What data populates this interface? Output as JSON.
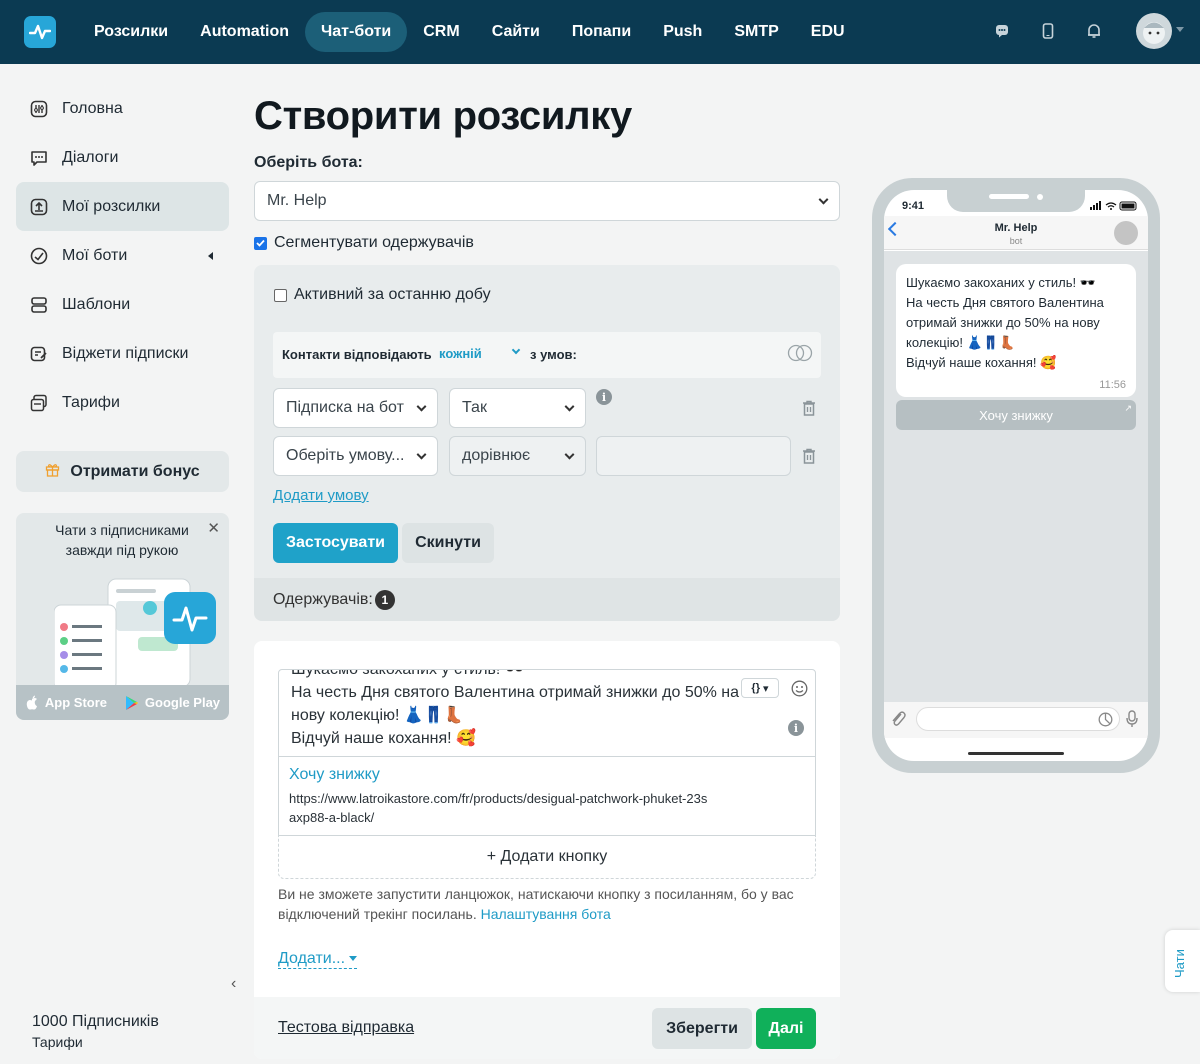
{
  "nav": {
    "items": [
      "Розсилки",
      "Automation",
      "Чат-боти",
      "CRM",
      "Сайти",
      "Попапи",
      "Push",
      "SMTP",
      "EDU"
    ],
    "active_index": 2
  },
  "sidebar": {
    "items": [
      {
        "label": "Головна",
        "icon": "dashboard-icon"
      },
      {
        "label": "Діалоги",
        "icon": "chat-icon"
      },
      {
        "label": "Мої розсилки",
        "icon": "upload-icon"
      },
      {
        "label": "Мої боти",
        "icon": "bot-icon"
      },
      {
        "label": "Шаблони",
        "icon": "templates-icon"
      },
      {
        "label": "Віджети підписки",
        "icon": "widget-icon"
      },
      {
        "label": "Тарифи",
        "icon": "tariffs-icon"
      }
    ],
    "active_index": 2,
    "bonus_label": "Отримати бонус",
    "promo_text": "Чати з підписниками завжди під рукою",
    "app_store": "App Store",
    "google_play": "Google Play",
    "subscribers": "1000 Підписників",
    "tariffs_link": "Тарифи"
  },
  "main": {
    "title": "Створити розсилку",
    "bot_label": "Оберіть бота:",
    "bot_value": "Mr. Help",
    "segment_label": "Сегментувати одержувачів",
    "active_label": "Активний за останню добу",
    "cond_prefix": "Контакти відповідають",
    "cond_mode": "кожній",
    "cond_suffix": "з умов:",
    "row1": {
      "field": "Підписка на бот",
      "op": "Так"
    },
    "row2": {
      "field": "Оберіть умову...",
      "op": "дорівнює",
      "value": ""
    },
    "add_condition": "Додати умову",
    "apply": "Застосувати",
    "reset": "Скинути",
    "recipients_label": "Одержувачів:",
    "recipients_count": "1",
    "message_lines": [
      "Шукаємо закоханих у стиль! 🕶️",
      "На честь Дня святого Валентина отримай знижки до 50% на нову колекцію! 👗👖👢",
      "Відчуй наше кохання! 🥰"
    ],
    "var_button": "{}",
    "button_name": "Хочу знижку",
    "button_url": "https://www.latroikastore.com/fr/products/desigual-patchwork-phuket-23saxp88-a-black/",
    "add_button": "+ Додати кнопку",
    "note": "Ви не зможете запустити ланцюжок, натискаючи кнопку з посиланням, бо у вас відключений трекінг посилань.",
    "note_link": "Налаштування бота",
    "add_more": "Додати...",
    "test_send": "Тестова відправка",
    "save": "Зберегти",
    "next": "Далі"
  },
  "preview": {
    "time": "9:41",
    "bot_name": "Mr. Help",
    "bot_sub": "bot",
    "message": "Шукаємо закоханих у стиль! 🕶️\nНа честь Дня святого Валентина отримай знижки до 50% на нову колекцію! 👗👖👢\nВідчуй наше кохання! 🥰",
    "msg_time": "11:56",
    "button": "Хочу знижку"
  },
  "chats_tab": "Чати",
  "colors": {
    "nav_bg": "#0b3a52",
    "accent": "#1fa2c9",
    "next": "#10b05a"
  }
}
